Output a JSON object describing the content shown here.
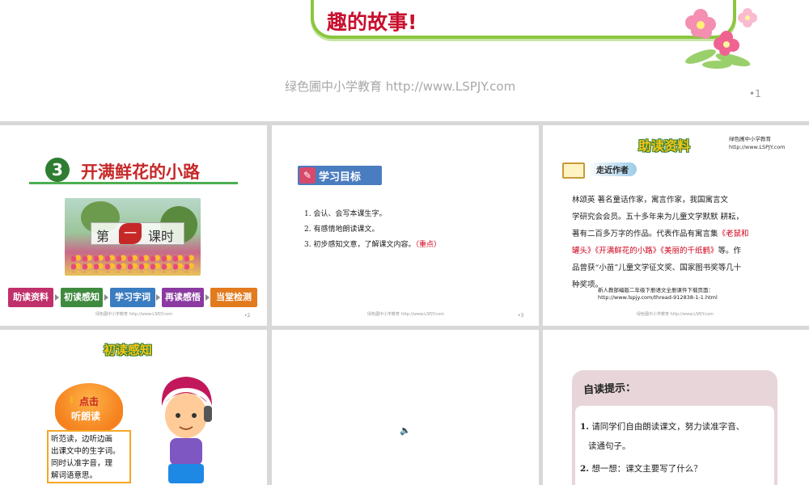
{
  "top_slide": {
    "banner_text": "趣的故事!",
    "watermark": "绿色圃中小学教育 http://www.LSPJY.com",
    "page_number": "•1"
  },
  "slide_title": {
    "lesson_number": "3",
    "lesson_title": "开满鲜花的小路",
    "period_left": "第",
    "period_mid": "一",
    "period_right": "课时",
    "nav": [
      "助读资料",
      "初读感知",
      "学习字词",
      "再读感悟",
      "当堂检测"
    ],
    "footer": "绿色圃中小学教育 http://www.LSPJY.com",
    "page_number": "•2"
  },
  "slide_goals": {
    "heading": "学习目标",
    "items": [
      "1. 会认、会写本课生字。",
      "2. 有感情地朗读课文。",
      "3. 初步感知文意，了解课文内容。"
    ],
    "highlight": "（重点）",
    "footer": "绿色圃中小学教育 http://www.LSPJY.com",
    "page_number": "•3"
  },
  "slide_author": {
    "title": "助读资料",
    "corner_text": "绿色圃中小学教育 http://www.LSPJY.com",
    "tag": "走近作者",
    "bio_lines": [
      "林颂英  著名童话作家，寓言作家，我国寓言文",
      "学研究会会员。五十多年来为儿童文学默默 耕耘，",
      "著有二百多万字的作品。代表作品有寓言集"
    ],
    "works_1": "《老鼠和",
    "works_2": "罐头》《开满鲜花的小路》《美丽的千纸鹤》",
    "bio_tail_1": "等。作",
    "bio_line_5": "品曾获“小苗”儿童文学征文奖、国家图书奖等几十",
    "bio_line_6": "种奖项。",
    "link_label": "新人教部编版二年级下册语文全册课件下载页面：",
    "link_url": "http://www.lspjy.com/thread-912838-1-1.html",
    "footer": "绿色圃中小学教育 http://www.LSPJY.com"
  },
  "slide_reading": {
    "title": "初读感知",
    "button_line1": "点击",
    "button_line2": "听朗读",
    "instruction": [
      "听范读，边听边画",
      "出课文中的生字词。",
      "同时认准字音，理",
      "解词语意思。"
    ]
  },
  "slide_audio": {
    "icon": "speaker-icon"
  },
  "slide_tips": {
    "title": "自读提示：",
    "tip1_num": "1.",
    "tip1_a": "请同学们自由朗读课文，努力读准字音、",
    "tip1_b": "读通句子。",
    "tip2_num": "2.",
    "tip2": "想一想：课文主要写了什么？"
  },
  "colors": {
    "accent_red": "#d0021b",
    "green": "#8cc63f",
    "nav": [
      "#c0306a",
      "#3f8a3f",
      "#3a7cc0",
      "#8a3aa0",
      "#e27a1e"
    ]
  }
}
